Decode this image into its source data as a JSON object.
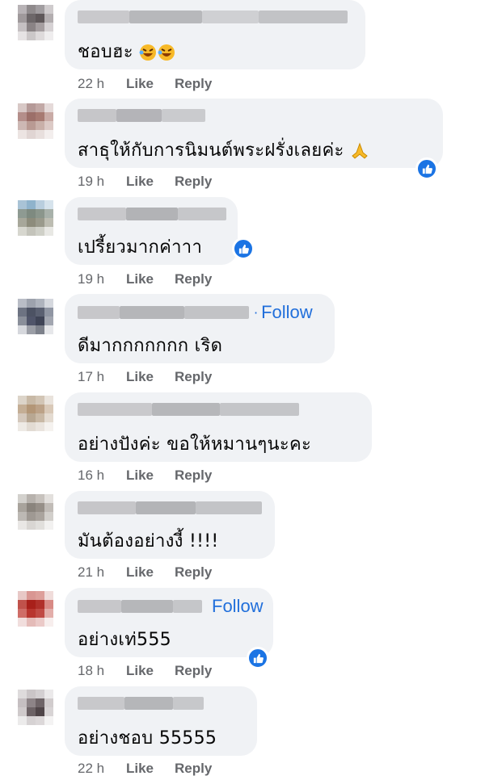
{
  "comments": [
    {
      "text": "ชอบฮะ",
      "emojis": "laughing-emoji x2",
      "time": "22 h",
      "like": "Like",
      "reply": "Reply",
      "follow": ""
    },
    {
      "text": "สาธุให้กับการนิมนต์พระฝรั่งเลยค่ะ",
      "emojis": "praying-hands",
      "time": "19 h",
      "like": "Like",
      "reply": "Reply",
      "follow": "",
      "reaction": "like"
    },
    {
      "text": "เปรี้ยวมากค่าาา",
      "time": "19 h",
      "like": "Like",
      "reply": "Reply",
      "follow": "",
      "reaction": "like"
    },
    {
      "text": "ดีมากกกกกกก เริด",
      "time": "17 h",
      "like": "Like",
      "reply": "Reply",
      "follow": "Follow"
    },
    {
      "text": "อย่างปังค่ะ ขอให้หมานๆนะคะ",
      "time": "16 h",
      "like": "Like",
      "reply": "Reply",
      "follow": ""
    },
    {
      "text": "มันต้องอย่างงี้ !!!!",
      "time": "21 h",
      "like": "Like",
      "reply": "Reply",
      "follow": ""
    },
    {
      "text": "อย่างเท่555",
      "time": "18 h",
      "like": "Like",
      "reply": "Reply",
      "follow": "Follow",
      "reaction": "like"
    },
    {
      "text": "อย่างชอบ 55555",
      "time": "22 h",
      "like": "Like",
      "reply": "Reply",
      "follow": ""
    }
  ],
  "colors": {
    "bubble": "#f0f2f5",
    "meta": "#65676b",
    "follow": "#216fdb",
    "like_badge": "#1b74e4"
  }
}
